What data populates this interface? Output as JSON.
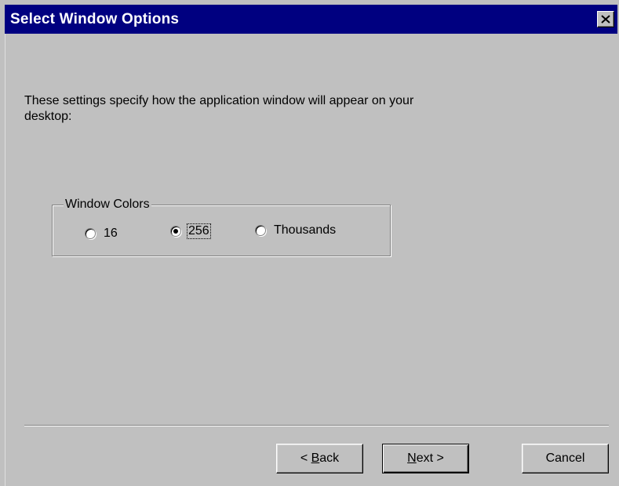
{
  "window": {
    "title": "Select Window Options",
    "close_symbol": "close-icon"
  },
  "intro": {
    "text": "These settings specify how the application window will appear on your desktop:"
  },
  "group": {
    "label": "Window Colors",
    "options": [
      {
        "label": "16",
        "checked": false
      },
      {
        "label": "256",
        "checked": true,
        "focused": true
      },
      {
        "label": "Thousands",
        "checked": false
      }
    ]
  },
  "buttons": {
    "back": {
      "prefix": "< ",
      "mnemonic": "B",
      "rest": "ack"
    },
    "next": {
      "mnemonic": "N",
      "rest": "ext >"
    },
    "cancel": "Cancel"
  },
  "colors": {
    "titlebar": "#000080",
    "dialog_bg": "#c0c0c0"
  }
}
